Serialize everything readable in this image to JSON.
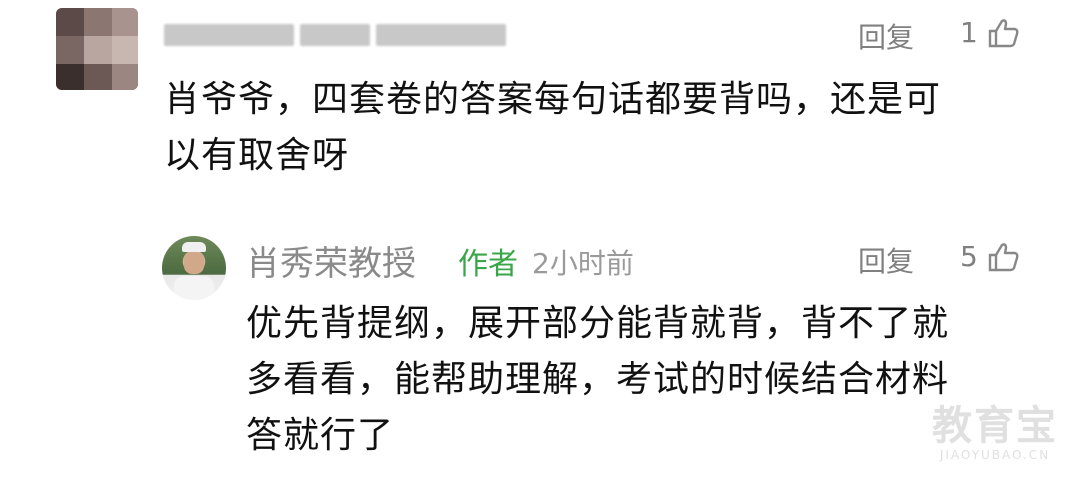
{
  "top_comment": {
    "text_line1": "肖爷爷，四套卷的答案每句话都要背吗，还是可",
    "text_line2": "以有取舍呀",
    "reply_label": "回复",
    "like_count": "1",
    "like_icon": "thumb-up-icon"
  },
  "reply": {
    "author": "肖秀荣教授",
    "badge": "作者",
    "time": "2小时前",
    "reply_label": "回复",
    "like_count": "5",
    "like_icon": "thumb-up-icon",
    "text_line1": "优先背提纲，展开部分能背就背，背不了就",
    "text_line2": "多看看，能帮助理解，考试的时候结合材料",
    "text_line3": "答就行了"
  },
  "watermark": {
    "main": "教育宝",
    "sub": "JIAOYUBAO.CN"
  }
}
